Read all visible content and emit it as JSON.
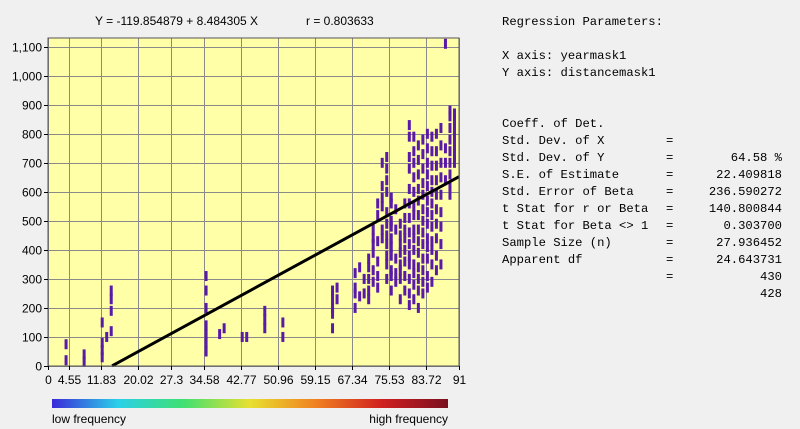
{
  "chart_data": {
    "type": "heatmap",
    "title": "Y = -119.854879 + 8.484305 X",
    "r_label": "r = 0.803633",
    "xlabel": "",
    "ylabel": "",
    "x_ticks": [
      "0",
      "4.55",
      "11.83",
      "20.02",
      "27.3",
      "34.58",
      "42.77",
      "50.96",
      "59.15",
      "67.34",
      "75.53",
      "83.72",
      "91"
    ],
    "y_ticks": [
      "0",
      "100",
      "200",
      "300",
      "400",
      "500",
      "600",
      "700",
      "800",
      "900",
      "1,000",
      "1,100"
    ],
    "xlim": [
      0,
      91
    ],
    "ylim": [
      0,
      1130
    ],
    "grid": true,
    "plot_background": "#ffffa8",
    "point_color": "#5a1aa8",
    "regression_line": {
      "intercept": -119.854879,
      "slope": 8.484305,
      "x_range": [
        14.2,
        91
      ],
      "color": "#000000"
    },
    "legend": {
      "low_label": "low frequency",
      "high_label": "high frequency",
      "colors": [
        "#3a2ad8",
        "#2ad0e8",
        "#40e070",
        "#e8e030",
        "#f08020",
        "#d02020",
        "#7a1020"
      ]
    },
    "points": [
      [
        4,
        20
      ],
      [
        4,
        75
      ],
      [
        8,
        15
      ],
      [
        8,
        40
      ],
      [
        12,
        30
      ],
      [
        12,
        55
      ],
      [
        12,
        80
      ],
      [
        12,
        150
      ],
      [
        13,
        100
      ],
      [
        14,
        120
      ],
      [
        14,
        260
      ],
      [
        14,
        230
      ],
      [
        14,
        190
      ],
      [
        35,
        50
      ],
      [
        35,
        80
      ],
      [
        35,
        110
      ],
      [
        35,
        140
      ],
      [
        35,
        200
      ],
      [
        35,
        260
      ],
      [
        35,
        310
      ],
      [
        38,
        110
      ],
      [
        39,
        130
      ],
      [
        43,
        100
      ],
      [
        44,
        100
      ],
      [
        48,
        130
      ],
      [
        48,
        160
      ],
      [
        48,
        190
      ],
      [
        52,
        100
      ],
      [
        52,
        150
      ],
      [
        63,
        130
      ],
      [
        63,
        180
      ],
      [
        63,
        200
      ],
      [
        63,
        230
      ],
      [
        63,
        260
      ],
      [
        64,
        230
      ],
      [
        64,
        270
      ],
      [
        68,
        320
      ],
      [
        68,
        270
      ],
      [
        68,
        250
      ],
      [
        68,
        200
      ],
      [
        69,
        240
      ],
      [
        69,
        340
      ],
      [
        70,
        300
      ],
      [
        70,
        250
      ],
      [
        71,
        230
      ],
      [
        71,
        260
      ],
      [
        71,
        300
      ],
      [
        71,
        340
      ],
      [
        71,
        370
      ],
      [
        72,
        290
      ],
      [
        72,
        330
      ],
      [
        72,
        390
      ],
      [
        72,
        420
      ],
      [
        72,
        440
      ],
      [
        72,
        470
      ],
      [
        73,
        270
      ],
      [
        73,
        310
      ],
      [
        73,
        360
      ],
      [
        73,
        430
      ],
      [
        73,
        520
      ],
      [
        73,
        560
      ],
      [
        74,
        440
      ],
      [
        74,
        470
      ],
      [
        74,
        550
      ],
      [
        74,
        580
      ],
      [
        74,
        620
      ],
      [
        74,
        700
      ],
      [
        75,
        300
      ],
      [
        75,
        350
      ],
      [
        75,
        380
      ],
      [
        75,
        420
      ],
      [
        75,
        450
      ],
      [
        75,
        490
      ],
      [
        75,
        530
      ],
      [
        75,
        600
      ],
      [
        75,
        640
      ],
      [
        75,
        680
      ],
      [
        75,
        720
      ],
      [
        76,
        260
      ],
      [
        76,
        310
      ],
      [
        76,
        330
      ],
      [
        76,
        380
      ],
      [
        76,
        410
      ],
      [
        76,
        440
      ],
      [
        76,
        480
      ],
      [
        76,
        500
      ],
      [
        76,
        560
      ],
      [
        76,
        580
      ],
      [
        77,
        290
      ],
      [
        77,
        320
      ],
      [
        77,
        370
      ],
      [
        77,
        470
      ],
      [
        77,
        540
      ],
      [
        78,
        230
      ],
      [
        78,
        300
      ],
      [
        78,
        330
      ],
      [
        78,
        350
      ],
      [
        78,
        390
      ],
      [
        78,
        420
      ],
      [
        78,
        450
      ],
      [
        78,
        490
      ],
      [
        79,
        260
      ],
      [
        79,
        310
      ],
      [
        79,
        360
      ],
      [
        79,
        400
      ],
      [
        79,
        440
      ],
      [
        79,
        470
      ],
      [
        79,
        510
      ],
      [
        79,
        560
      ],
      [
        80,
        210
      ],
      [
        80,
        250
      ],
      [
        80,
        300
      ],
      [
        80,
        350
      ],
      [
        80,
        380
      ],
      [
        80,
        420
      ],
      [
        80,
        460
      ],
      [
        80,
        510
      ],
      [
        80,
        560
      ],
      [
        80,
        610
      ],
      [
        80,
        680
      ],
      [
        80,
        720
      ],
      [
        80,
        790
      ],
      [
        80,
        830
      ],
      [
        81,
        230
      ],
      [
        81,
        280
      ],
      [
        81,
        320
      ],
      [
        81,
        350
      ],
      [
        81,
        400
      ],
      [
        81,
        440
      ],
      [
        81,
        470
      ],
      [
        81,
        520
      ],
      [
        81,
        550
      ],
      [
        81,
        600
      ],
      [
        81,
        650
      ],
      [
        81,
        700
      ],
      [
        81,
        740
      ],
      [
        81,
        790
      ],
      [
        82,
        200
      ],
      [
        82,
        260
      ],
      [
        82,
        300
      ],
      [
        82,
        340
      ],
      [
        82,
        390
      ],
      [
        82,
        430
      ],
      [
        82,
        470
      ],
      [
        82,
        520
      ],
      [
        82,
        570
      ],
      [
        82,
        610
      ],
      [
        82,
        660
      ],
      [
        82,
        710
      ],
      [
        82,
        760
      ],
      [
        83,
        250
      ],
      [
        83,
        290
      ],
      [
        83,
        330
      ],
      [
        83,
        370
      ],
      [
        83,
        420
      ],
      [
        83,
        460
      ],
      [
        83,
        500
      ],
      [
        83,
        540
      ],
      [
        83,
        590
      ],
      [
        83,
        630
      ],
      [
        83,
        680
      ],
      [
        83,
        730
      ],
      [
        83,
        780
      ],
      [
        84,
        270
      ],
      [
        84,
        310
      ],
      [
        84,
        370
      ],
      [
        84,
        410
      ],
      [
        84,
        440
      ],
      [
        84,
        490
      ],
      [
        84,
        530
      ],
      [
        84,
        570
      ],
      [
        84,
        620
      ],
      [
        84,
        660
      ],
      [
        84,
        700
      ],
      [
        84,
        750
      ],
      [
        84,
        800
      ],
      [
        85,
        290
      ],
      [
        85,
        350
      ],
      [
        85,
        400
      ],
      [
        85,
        430
      ],
      [
        85,
        480
      ],
      [
        85,
        520
      ],
      [
        85,
        560
      ],
      [
        85,
        600
      ],
      [
        85,
        640
      ],
      [
        85,
        690
      ],
      [
        85,
        740
      ],
      [
        85,
        790
      ],
      [
        86,
        330
      ],
      [
        86,
        380
      ],
      [
        86,
        440
      ],
      [
        86,
        490
      ],
      [
        86,
        540
      ],
      [
        86,
        590
      ],
      [
        86,
        640
      ],
      [
        86,
        690
      ],
      [
        86,
        740
      ],
      [
        86,
        800
      ],
      [
        87,
        350
      ],
      [
        87,
        420
      ],
      [
        87,
        480
      ],
      [
        87,
        530
      ],
      [
        87,
        590
      ],
      [
        87,
        650
      ],
      [
        87,
        700
      ],
      [
        87,
        760
      ],
      [
        87,
        820
      ],
      [
        88,
        1110
      ],
      [
        88,
        750
      ],
      [
        88,
        700
      ],
      [
        88,
        640
      ],
      [
        89,
        590
      ],
      [
        89,
        620
      ],
      [
        89,
        660
      ],
      [
        89,
        700
      ],
      [
        89,
        740
      ],
      [
        89,
        780
      ],
      [
        89,
        820
      ],
      [
        89,
        860
      ],
      [
        89,
        880
      ],
      [
        90,
        700
      ],
      [
        90,
        730
      ],
      [
        90,
        760
      ],
      [
        90,
        790
      ],
      [
        90,
        820
      ],
      [
        90,
        850
      ],
      [
        90,
        870
      ]
    ]
  },
  "parameters": {
    "heading": "Regression Parameters:",
    "x_axis": "X axis: yearmask1",
    "y_axis": "Y axis: distancemask1",
    "rows": [
      {
        "name": "Coeff. of Det.",
        "eq": "=",
        "value": "64.58 %"
      },
      {
        "name": "Std. Dev. of X",
        "eq": "=",
        "value": "22.409818"
      },
      {
        "name": "Std. Dev. of Y",
        "eq": "=",
        "value": "236.590272"
      },
      {
        "name": "S.E. of Estimate",
        "eq": "=",
        "value": "140.800844"
      },
      {
        "name": "Std. Error of Beta",
        "eq": "=",
        "value": "0.303700"
      },
      {
        "name": "t Stat for r or Beta",
        "eq": "=",
        "value": "27.936452"
      },
      {
        "name": "t Stat for Beta <> 1",
        "eq": "=",
        "value": "24.643731"
      },
      {
        "name": "Sample Size (n)",
        "eq": "=",
        "value": "430"
      },
      {
        "name": "Apparent df",
        "eq": "=",
        "value": "428"
      }
    ]
  }
}
